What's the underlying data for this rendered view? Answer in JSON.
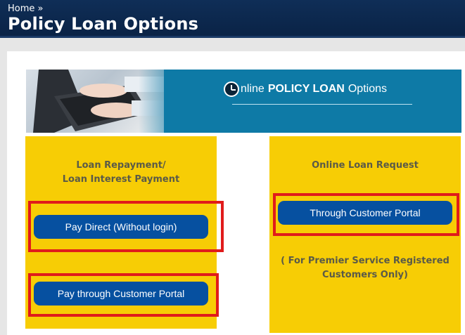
{
  "header": {
    "breadcrumb_home": "Home",
    "breadcrumb_sep": "»",
    "title": "Policy Loan Options"
  },
  "banner": {
    "title_prefix": "nline",
    "title_strong": "POLICY LOAN",
    "title_suffix": "Options"
  },
  "repayment": {
    "heading_line1": "Loan Repayment/",
    "heading_line2": "Loan Interest Payment",
    "pay_direct_label": "Pay Direct (Without login)",
    "pay_portal_label": "Pay through Customer Portal"
  },
  "request": {
    "heading": "Online Loan Request",
    "portal_label": "Through Customer Portal",
    "note_line1": "( For Premier Service Registered",
    "note_line2": "Customers Only)"
  },
  "colors": {
    "header": "#0f2e57",
    "panel": "#f7cd05",
    "button": "#0650a0",
    "highlight": "#e01b1b",
    "banner": "#0e7aa6"
  }
}
